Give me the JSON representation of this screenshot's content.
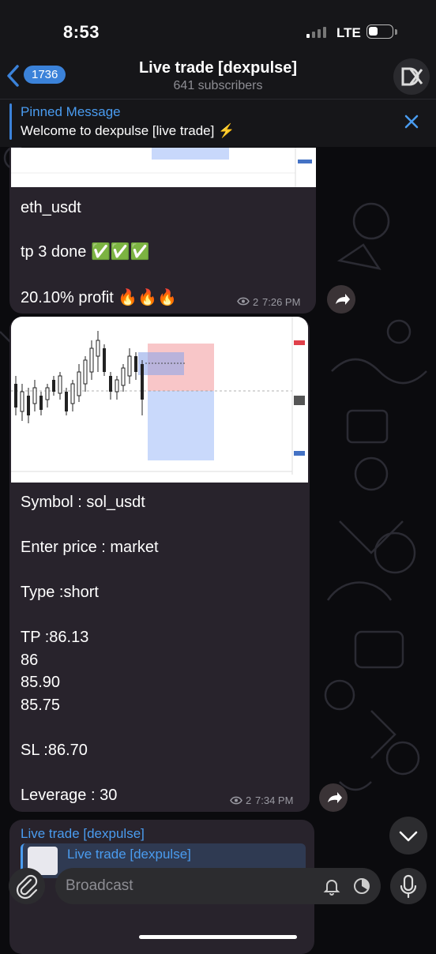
{
  "status": {
    "time": "8:53",
    "network": "LTE"
  },
  "header": {
    "back_count": "1736",
    "title": "Live trade [dexpulse]",
    "subtitle": "641 subscribers"
  },
  "pinned": {
    "title": "Pinned Message",
    "text": "Welcome to  dexpulse [live trade] ⚡"
  },
  "messages": [
    {
      "lines": [
        "eth_usdt",
        "tp 3 done ✅✅✅",
        "20.10% profit 🔥🔥🔥"
      ],
      "views": "2",
      "time": "7:26 PM"
    },
    {
      "lines": [
        "Symbol : sol_usdt",
        "Enter price : market",
        "Type :short",
        "TP :86.13",
        "86",
        "85.90",
        "85.75",
        "SL :86.70",
        "Leverage : 30"
      ],
      "views": "2",
      "time": "7:34 PM"
    }
  ],
  "forwarded": {
    "channel": "Live trade [dexpulse]",
    "quote_title": "Live trade [dexpulse]"
  },
  "input": {
    "placeholder": "Broadcast"
  },
  "colors": {
    "accent": "#3b82d9",
    "bubble": "#28232c",
    "background": "#0b0b0e"
  }
}
